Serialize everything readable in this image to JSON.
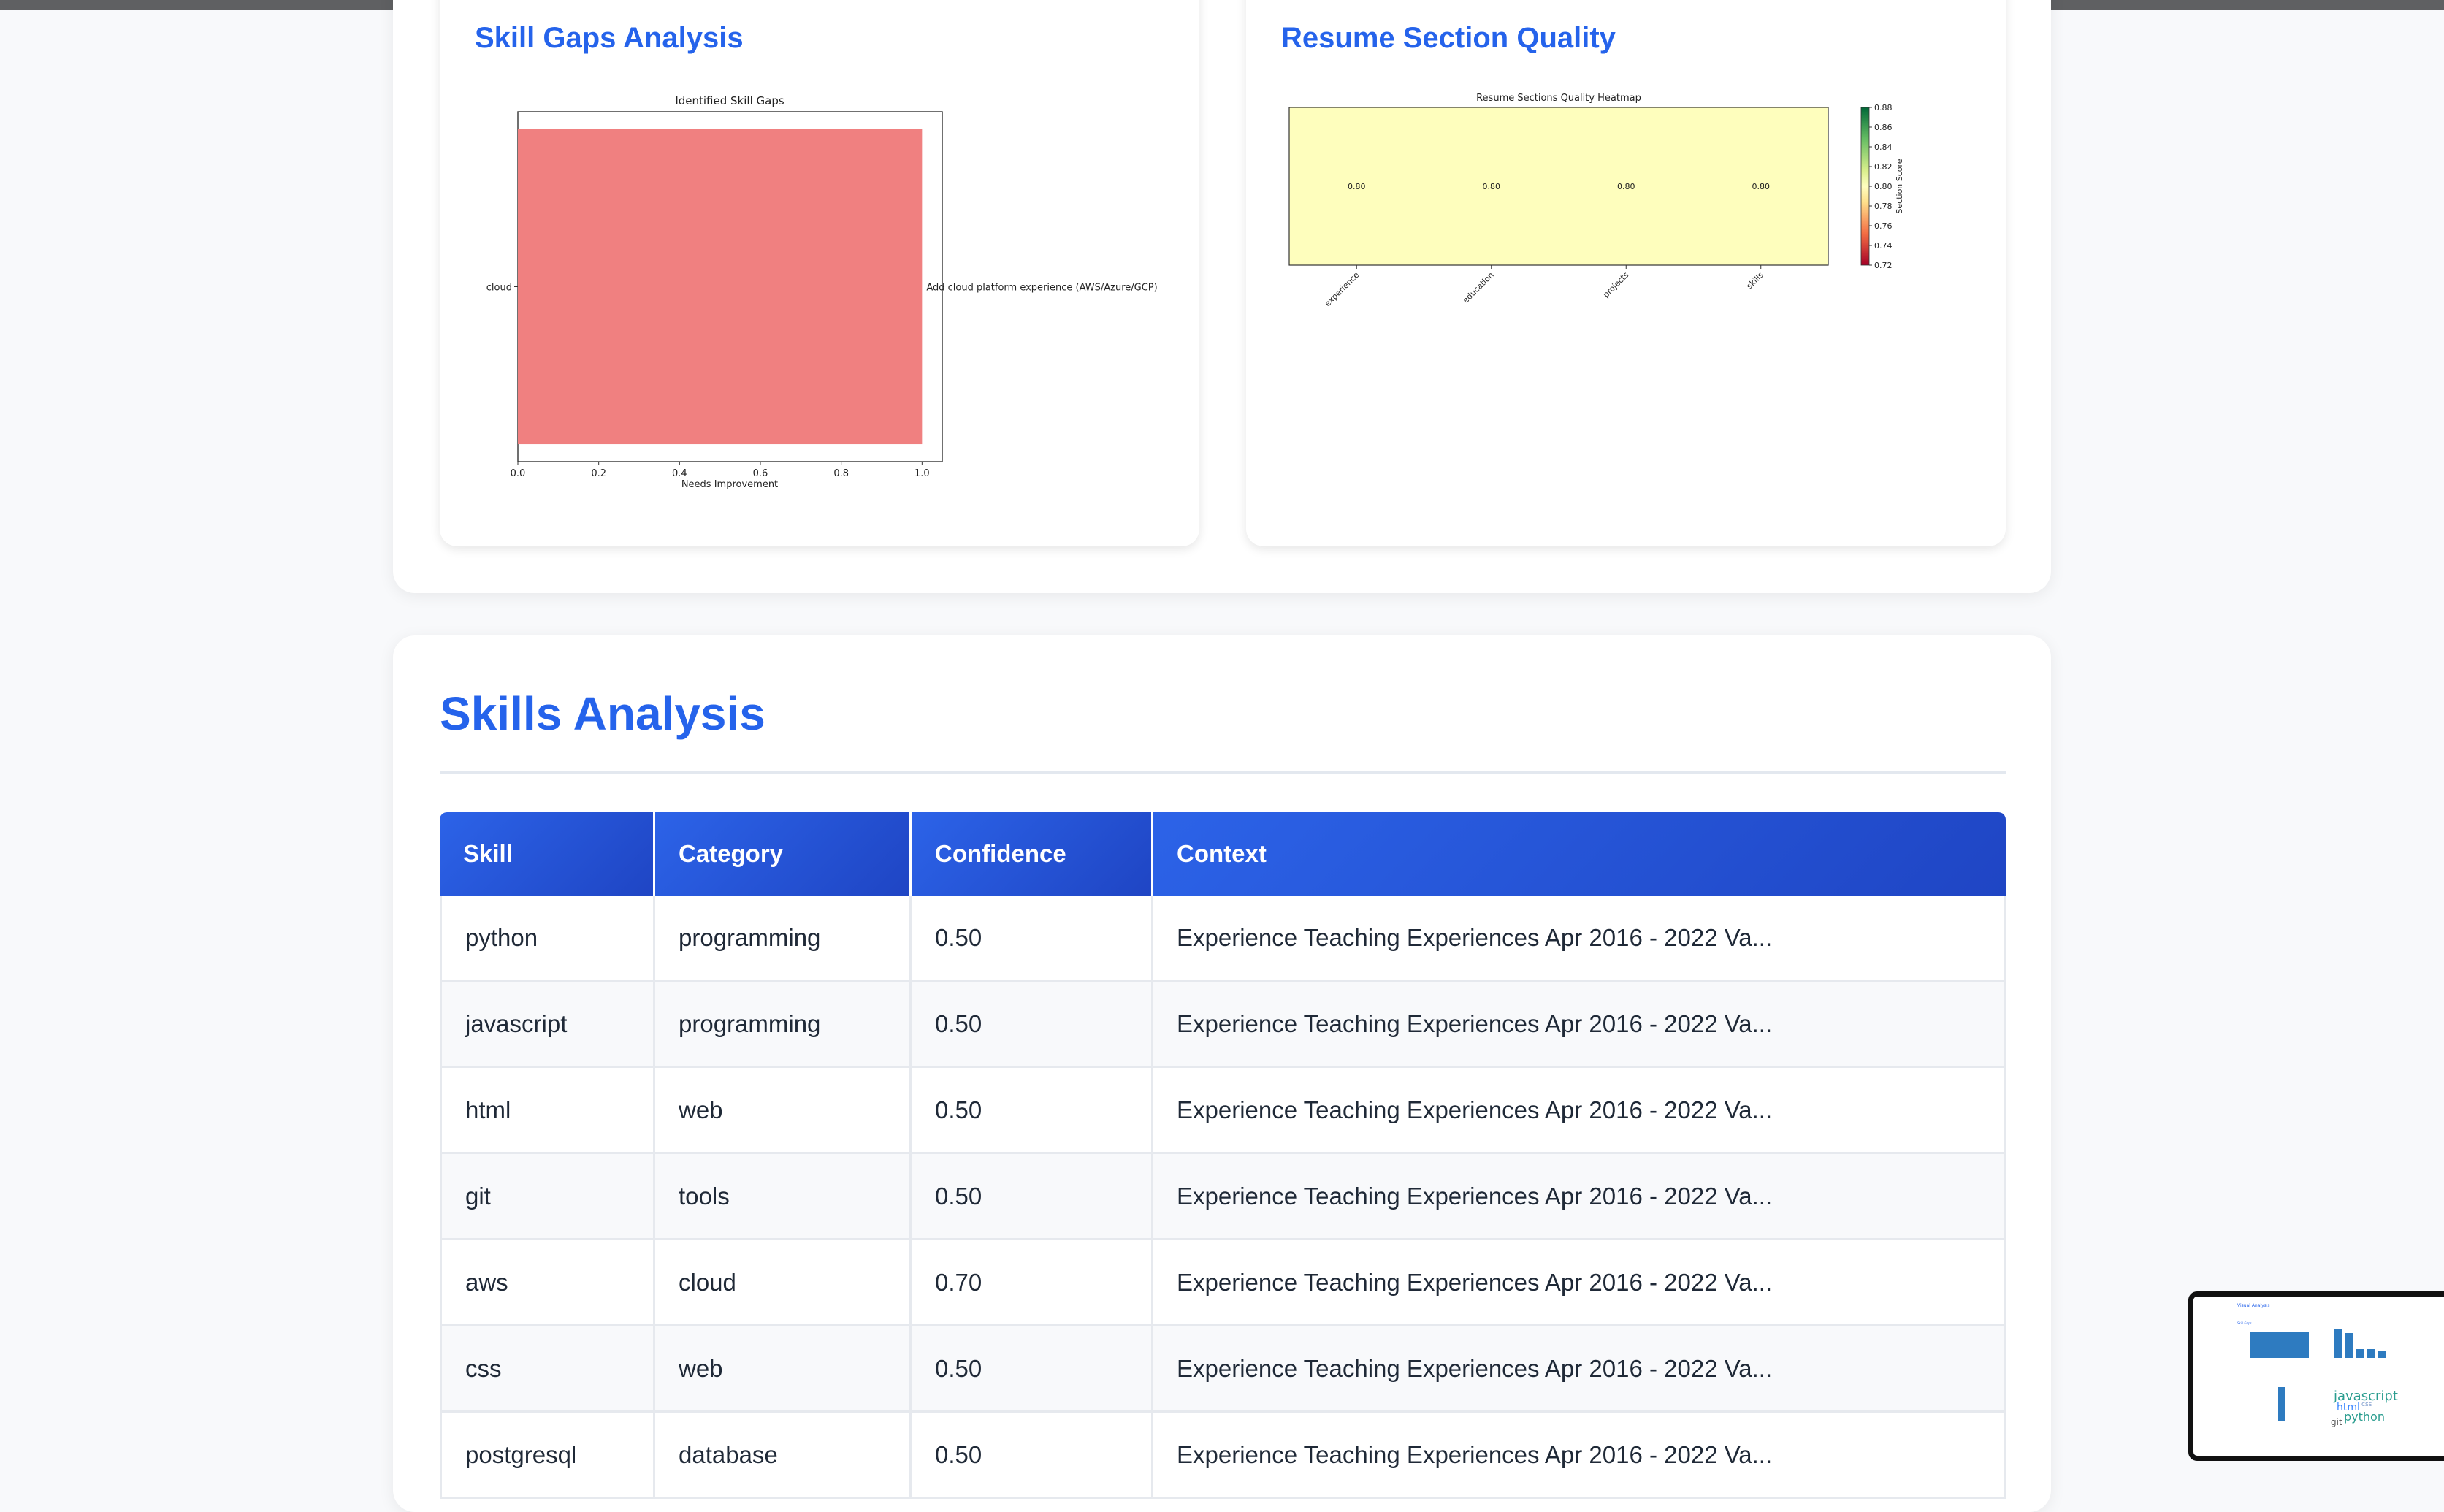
{
  "visual_analysis": {
    "skill_gaps_title": "Skill Gaps Analysis",
    "section_quality_title": "Resume Section Quality"
  },
  "chart_data": [
    {
      "type": "bar",
      "orientation": "horizontal",
      "title": "Identified Skill Gaps",
      "xlabel": "Needs Improvement",
      "ylabel": "",
      "categories": [
        "cloud"
      ],
      "values": [
        1.0
      ],
      "bar_labels": [
        "Add cloud platform experience (AWS/Azure/GCP)"
      ],
      "xlim": [
        0,
        1.05
      ],
      "xticks": [
        "0.0",
        "0.2",
        "0.4",
        "0.6",
        "0.8",
        "1.0"
      ],
      "bar_color": "#f08080",
      "grid": false
    },
    {
      "type": "heatmap",
      "title": "Resume Sections Quality Heatmap",
      "columns": [
        "experience",
        "education",
        "projects",
        "skills"
      ],
      "values": [
        [
          0.8,
          0.8,
          0.8,
          0.8
        ]
      ],
      "value_labels": [
        "0.80",
        "0.80",
        "0.80",
        "0.80"
      ],
      "colorbar_label": "Section Score",
      "colorbar_ticks": [
        "0.88",
        "0.86",
        "0.84",
        "0.82",
        "0.80",
        "0.78",
        "0.76",
        "0.74",
        "0.72"
      ],
      "colormap": "RdYlGn",
      "cell_color": "#fefebd"
    }
  ],
  "skills": {
    "title": "Skills Analysis",
    "columns": [
      "Skill",
      "Category",
      "Confidence",
      "Context"
    ],
    "rows": [
      {
        "skill": "python",
        "category": "programming",
        "confidence": "0.50",
        "context": "Experience Teaching Experiences Apr 2016 - 2022 Va..."
      },
      {
        "skill": "javascript",
        "category": "programming",
        "confidence": "0.50",
        "context": "Experience Teaching Experiences Apr 2016 - 2022 Va..."
      },
      {
        "skill": "html",
        "category": "web",
        "confidence": "0.50",
        "context": "Experience Teaching Experiences Apr 2016 - 2022 Va..."
      },
      {
        "skill": "git",
        "category": "tools",
        "confidence": "0.50",
        "context": "Experience Teaching Experiences Apr 2016 - 2022 Va..."
      },
      {
        "skill": "aws",
        "category": "cloud",
        "confidence": "0.70",
        "context": "Experience Teaching Experiences Apr 2016 - 2022 Va..."
      },
      {
        "skill": "css",
        "category": "web",
        "confidence": "0.50",
        "context": "Experience Teaching Experiences Apr 2016 - 2022 Va..."
      },
      {
        "skill": "postgresql",
        "category": "database",
        "confidence": "0.50",
        "context": "Experience Teaching Experiences Apr 2016 - 2022 Va..."
      }
    ]
  },
  "minimap": {
    "title": "Visual Analysis",
    "word_cloud": [
      "javascript",
      "html",
      "python",
      "git",
      "css"
    ]
  }
}
